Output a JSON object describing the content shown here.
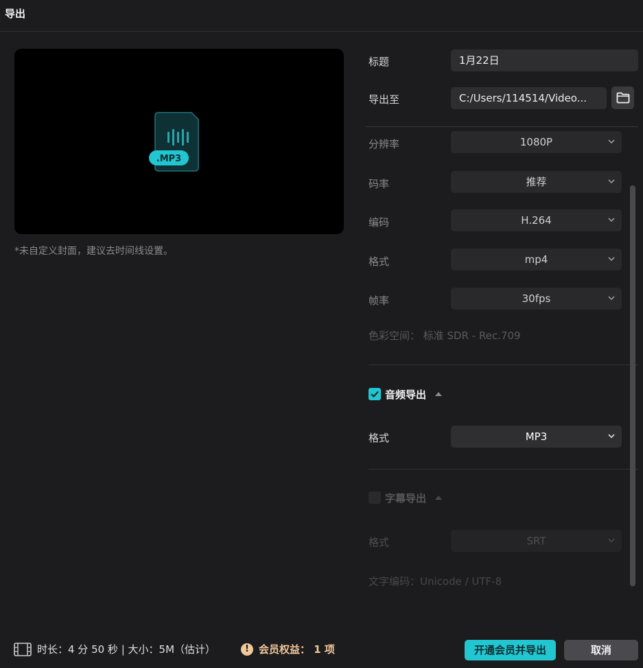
{
  "window": {
    "title": "导出"
  },
  "preview": {
    "file_badge": ".MP3",
    "cover_note": "*未自定义封面，建议去时间线设置。"
  },
  "form": {
    "title_label": "标题",
    "title_value": "1月22日",
    "export_to_label": "导出至",
    "export_path": "C:/Users/114514/Video..."
  },
  "video": {
    "resolution_label": "分辨率",
    "resolution_value": "1080P",
    "bitrate_label": "码率",
    "bitrate_value": "推荐",
    "codec_label": "编码",
    "codec_value": "H.264",
    "format_label": "格式",
    "format_value": "mp4",
    "framerate_label": "帧率",
    "framerate_value": "30fps",
    "colorspace_text": "色彩空间： 标准 SDR - Rec.709"
  },
  "audio": {
    "section_title": "音频导出",
    "checked": true,
    "format_label": "格式",
    "format_value": "MP3"
  },
  "subtitle": {
    "section_title": "字幕导出",
    "checked": false,
    "format_label": "格式",
    "format_value": "SRT",
    "encoding_text": "文字编码：Unicode / UTF-8"
  },
  "footer": {
    "info": "时长：4 分 50 秒 | 大小：5M（估计）",
    "vip_label": "会员权益：",
    "vip_count": "1 项",
    "vip_button": "开通会员并导出",
    "cancel_button": "取消"
  },
  "colors": {
    "accent": "#21c6d0",
    "vip": "#f2c89b",
    "background": "#1c1c1e"
  }
}
